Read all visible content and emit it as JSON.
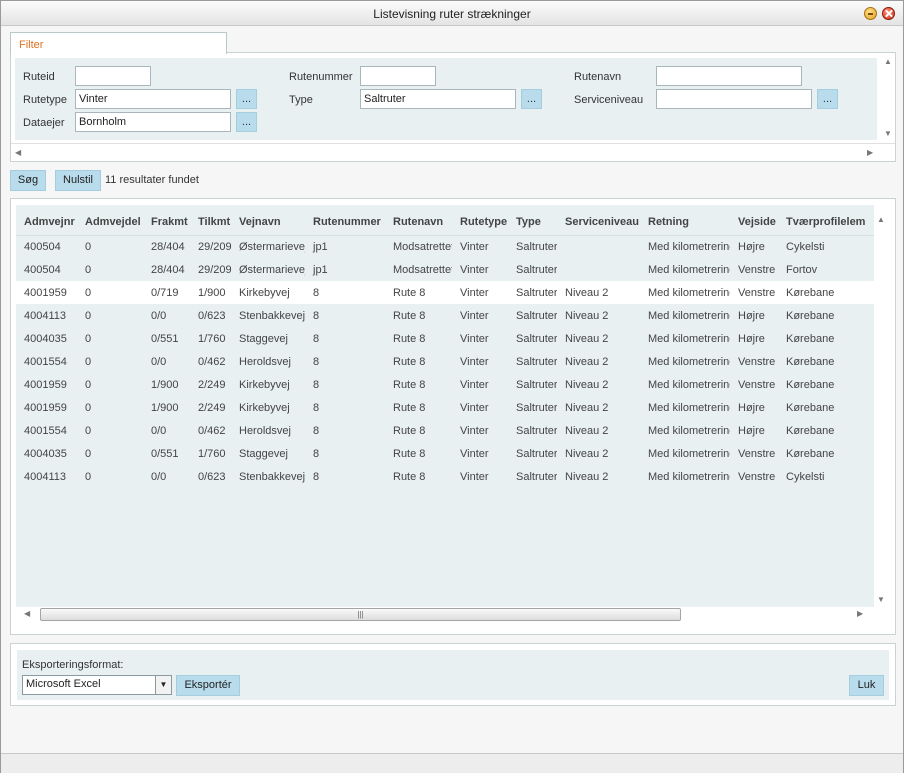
{
  "window": {
    "title": "Listevisning ruter strækninger"
  },
  "filter": {
    "tab_label": "Filter",
    "fields": {
      "ruteid": {
        "label": "Ruteid",
        "value": ""
      },
      "rutenummer": {
        "label": "Rutenummer",
        "value": ""
      },
      "rutenavn": {
        "label": "Rutenavn",
        "value": ""
      },
      "rutetype": {
        "label": "Rutetype",
        "value": "Vinter"
      },
      "type": {
        "label": "Type",
        "value": "Saltruter"
      },
      "serviceniveau": {
        "label": "Serviceniveau",
        "value": ""
      },
      "dataejer": {
        "label": "Dataejer",
        "value": "Bornholm"
      }
    },
    "browse_label": "..."
  },
  "actions": {
    "search_label": "Søg",
    "reset_label": "Nulstil",
    "results_text": "11 resultater fundet"
  },
  "grid": {
    "columns": [
      "Admvejnr",
      "Admvejdel",
      "Frakmt",
      "Tilkmt",
      "Vejnavn",
      "Rutenummer",
      "Rutenavn",
      "Rutetype",
      "Type",
      "Serviceniveau",
      "Retning",
      "Vejside",
      "Tværprofilelem"
    ],
    "selected_row": 2,
    "rows": [
      [
        "400504",
        "0",
        "28/404",
        "29/209",
        "Østermarievej",
        "jp1",
        "Modsatrettet",
        "Vinter",
        "Saltruter",
        "",
        "Med kilometrering",
        "Højre",
        "Cykelsti"
      ],
      [
        "400504",
        "0",
        "28/404",
        "29/209",
        "Østermarievej",
        "jp1",
        "Modsatrettet",
        "Vinter",
        "Saltruter",
        "",
        "Med kilometrering",
        "Venstre",
        "Fortov"
      ],
      [
        "4001959",
        "0",
        "0/719",
        "1/900",
        "Kirkebyvej",
        "8",
        "Rute 8",
        "Vinter",
        "Saltruter",
        "Niveau 2",
        "Med kilometrering",
        "Venstre",
        "Kørebane"
      ],
      [
        "4004113",
        "0",
        "0/0",
        "0/623",
        "Stenbakkevej",
        "8",
        "Rute 8",
        "Vinter",
        "Saltruter",
        "Niveau 2",
        "Med kilometrering",
        "Højre",
        "Kørebane"
      ],
      [
        "4004035",
        "0",
        "0/551",
        "1/760",
        "Staggevej",
        "8",
        "Rute 8",
        "Vinter",
        "Saltruter",
        "Niveau 2",
        "Med kilometrering",
        "Højre",
        "Kørebane"
      ],
      [
        "4001554",
        "0",
        "0/0",
        "0/462",
        "Heroldsvej",
        "8",
        "Rute 8",
        "Vinter",
        "Saltruter",
        "Niveau 2",
        "Med kilometrering",
        "Venstre",
        "Kørebane"
      ],
      [
        "4001959",
        "0",
        "1/900",
        "2/249",
        "Kirkebyvej",
        "8",
        "Rute 8",
        "Vinter",
        "Saltruter",
        "Niveau 2",
        "Med kilometrering",
        "Venstre",
        "Kørebane"
      ],
      [
        "4001959",
        "0",
        "1/900",
        "2/249",
        "Kirkebyvej",
        "8",
        "Rute 8",
        "Vinter",
        "Saltruter",
        "Niveau 2",
        "Med kilometrering",
        "Højre",
        "Kørebane"
      ],
      [
        "4001554",
        "0",
        "0/0",
        "0/462",
        "Heroldsvej",
        "8",
        "Rute 8",
        "Vinter",
        "Saltruter",
        "Niveau 2",
        "Med kilometrering",
        "Højre",
        "Kørebane"
      ],
      [
        "4004035",
        "0",
        "0/551",
        "1/760",
        "Staggevej",
        "8",
        "Rute 8",
        "Vinter",
        "Saltruter",
        "Niveau 2",
        "Med kilometrering",
        "Venstre",
        "Kørebane"
      ],
      [
        "4004113",
        "0",
        "0/0",
        "0/623",
        "Stenbakkevej",
        "8",
        "Rute 8",
        "Vinter",
        "Saltruter",
        "Niveau 2",
        "Med kilometrering",
        "Venstre",
        "Cykelsti"
      ]
    ]
  },
  "export": {
    "format_label": "Eksporteringsformat:",
    "format_value": "Microsoft Excel",
    "export_label": "Eksportér",
    "close_label": "Luk"
  },
  "colors": {
    "tab_text": "#e07020",
    "button_bg": "#b8dcec",
    "panel_bg": "#e8f0f2"
  }
}
